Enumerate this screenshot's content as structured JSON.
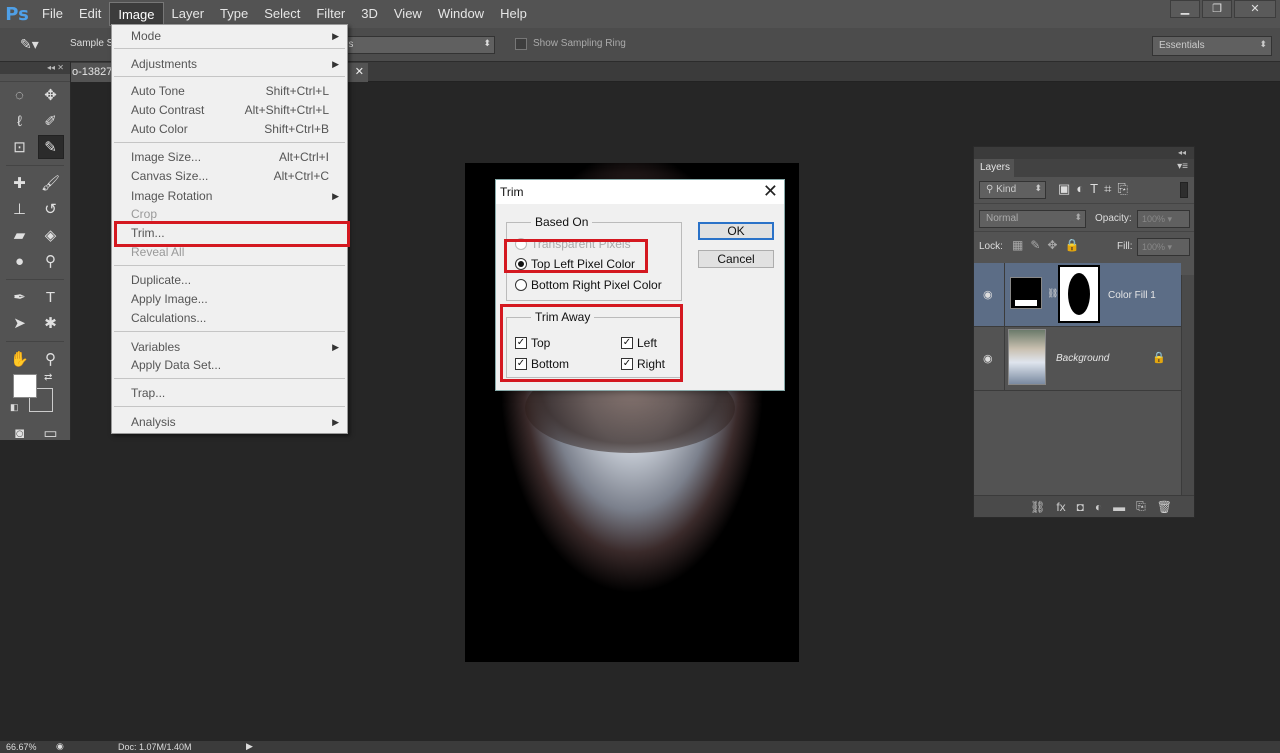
{
  "app": {
    "logo": "Ps"
  },
  "menubar": {
    "items": [
      "File",
      "Edit",
      "Image",
      "Layer",
      "Type",
      "Select",
      "Filter",
      "3D",
      "View",
      "Window",
      "Help"
    ],
    "active": "Image"
  },
  "window_controls": {
    "minimize_icon": "minimize-icon",
    "restore_icon": "restore-icon",
    "close_icon": "close-icon"
  },
  "options_bar": {
    "tool_icon": "eyedropper-icon",
    "sample_label": "Sample S",
    "sample_value": "rs",
    "show_sampling_ring": "Show Sampling Ring",
    "workspace": "Essentials"
  },
  "document_tab": {
    "title": "o-13827",
    "close": "✕"
  },
  "image_menu": {
    "items": [
      {
        "label": "Mode",
        "shortcut": "",
        "submenu": true,
        "disabled": false
      },
      {
        "label": "Adjustments",
        "shortcut": "",
        "submenu": true,
        "disabled": false
      },
      {
        "label": "Auto Tone",
        "shortcut": "Shift+Ctrl+L",
        "submenu": false,
        "disabled": false
      },
      {
        "label": "Auto Contrast",
        "shortcut": "Alt+Shift+Ctrl+L",
        "submenu": false,
        "disabled": false
      },
      {
        "label": "Auto Color",
        "shortcut": "Shift+Ctrl+B",
        "submenu": false,
        "disabled": false
      },
      {
        "label": "Image Size...",
        "shortcut": "Alt+Ctrl+I",
        "submenu": false,
        "disabled": false
      },
      {
        "label": "Canvas Size...",
        "shortcut": "Alt+Ctrl+C",
        "submenu": false,
        "disabled": false
      },
      {
        "label": "Image Rotation",
        "shortcut": "",
        "submenu": true,
        "disabled": false
      },
      {
        "label": "Crop",
        "shortcut": "",
        "submenu": false,
        "disabled": true
      },
      {
        "label": "Trim...",
        "shortcut": "",
        "submenu": false,
        "disabled": false
      },
      {
        "label": "Reveal All",
        "shortcut": "",
        "submenu": false,
        "disabled": true
      },
      {
        "label": "Duplicate...",
        "shortcut": "",
        "submenu": false,
        "disabled": false
      },
      {
        "label": "Apply Image...",
        "shortcut": "",
        "submenu": false,
        "disabled": false
      },
      {
        "label": "Calculations...",
        "shortcut": "",
        "submenu": false,
        "disabled": false
      },
      {
        "label": "Variables",
        "shortcut": "",
        "submenu": true,
        "disabled": false
      },
      {
        "label": "Apply Data Set...",
        "shortcut": "",
        "submenu": false,
        "disabled": false
      },
      {
        "label": "Trap...",
        "shortcut": "",
        "submenu": false,
        "disabled": false
      },
      {
        "label": "Analysis",
        "shortcut": "",
        "submenu": true,
        "disabled": false
      }
    ]
  },
  "trim_dialog": {
    "title": "Trim",
    "based_on_label": "Based On",
    "based_on_options": [
      {
        "label": "Transparent Pixels",
        "selected": false,
        "disabled": true
      },
      {
        "label": "Top Left Pixel Color",
        "selected": true,
        "disabled": false
      },
      {
        "label": "Bottom Right Pixel Color",
        "selected": false,
        "disabled": false
      }
    ],
    "trim_away_label": "Trim Away",
    "trim_away": {
      "top": {
        "label": "Top",
        "checked": true
      },
      "bottom": {
        "label": "Bottom",
        "checked": true
      },
      "left": {
        "label": "Left",
        "checked": true
      },
      "right": {
        "label": "Right",
        "checked": true
      }
    },
    "ok": "OK",
    "cancel": "Cancel",
    "close": "✕",
    "highlight_color": "#d41820"
  },
  "layers_panel": {
    "tab": "Layers",
    "kind": "Kind",
    "blend_mode": "Normal",
    "opacity_label": "Opacity:",
    "opacity_value": "100%",
    "lock_label": "Lock:",
    "fill_label": "Fill:",
    "fill_value": "100%",
    "layers": [
      {
        "name": "Color Fill 1",
        "selected": true,
        "locked": false
      },
      {
        "name": "Background",
        "selected": false,
        "locked": true
      }
    ]
  },
  "status_bar": {
    "zoom": "66.67%",
    "doc": "Doc: 1.07M/1.40M"
  },
  "colors": {
    "menubar": "#535353",
    "workspace": "#262626",
    "selection": "#5c6d86",
    "ps_blue": "#4fa0e8"
  }
}
